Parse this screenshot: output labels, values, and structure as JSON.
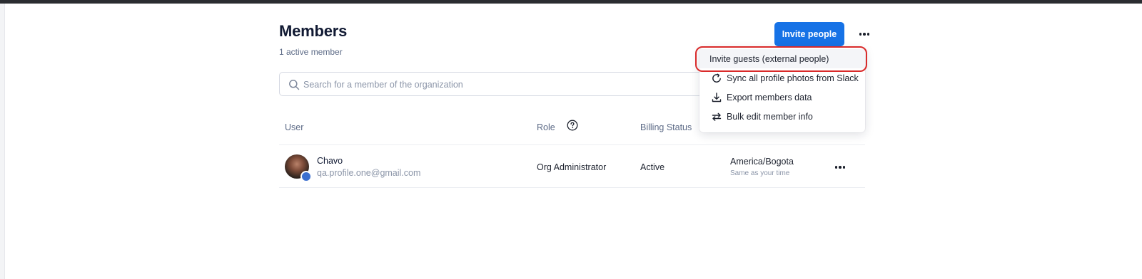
{
  "header": {
    "title": "Members",
    "subtitle": "1 active member",
    "invite_label": "Invite people",
    "more_icon": "more-horizontal-icon"
  },
  "search": {
    "placeholder": "Search for a member of the organization",
    "value": ""
  },
  "table": {
    "columns": [
      "User",
      "Role",
      "Billing Status"
    ],
    "rows": [
      {
        "name": "Chavo",
        "email": "qa.profile.one@gmail.com",
        "role": "Org Administrator",
        "billing": "Active",
        "timezone": "America/Bogota",
        "timezone_note": "Same as your time"
      }
    ]
  },
  "menu": {
    "items": [
      {
        "label": "Invite guests (external people)",
        "icon": ""
      },
      {
        "label": "Sync all profile photos from Slack",
        "icon": "sync-icon"
      },
      {
        "label": "Export members data",
        "icon": "download-icon"
      },
      {
        "label": "Bulk edit member info",
        "icon": "swap-icon"
      }
    ]
  },
  "colors": {
    "primary": "#1672e6",
    "highlight": "#d92a2a"
  }
}
